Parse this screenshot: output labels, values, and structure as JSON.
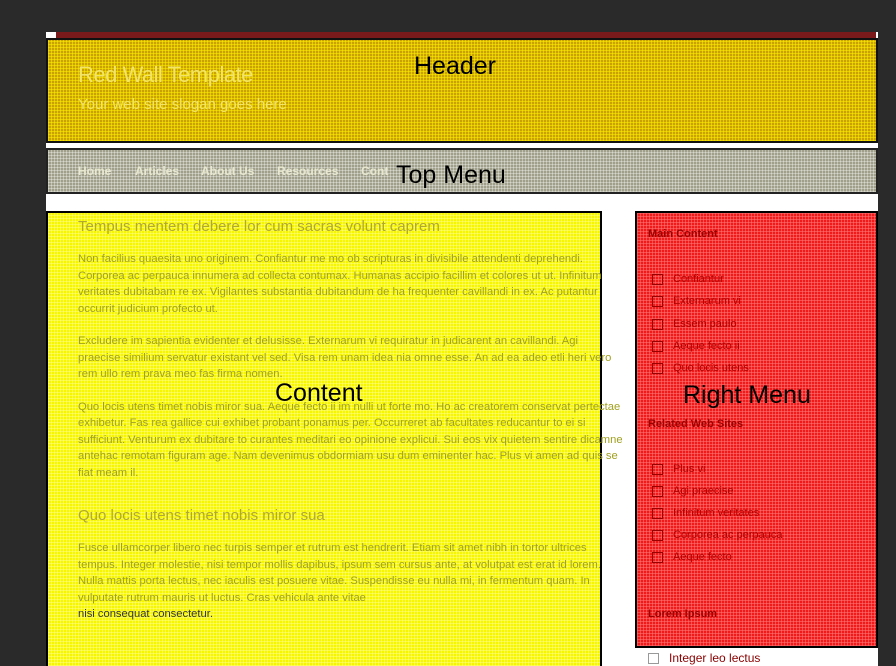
{
  "header": {
    "site_title": "Red Wall Template",
    "slogan": "Your web site slogan goes here",
    "region_label": "Header"
  },
  "topmenu": {
    "region_label": "Top Menu",
    "items": [
      "Home",
      "Articles",
      "About Us",
      "Resources",
      "Cont"
    ]
  },
  "content": {
    "region_label": "Content",
    "heading1": "Tempus mentem debere lor cum sacras volunt caprem",
    "para1": "Non facilius quaesita uno originem. Confiantur me mo ob scripturas in divisibile attendenti deprehendi. Corporea ac perpauca innumera ad collecta contumax. Humanas accipio facillim et colores ut ut. Infinitum veritates dubitabam re ex. Vigilantes substantia dubitandum de ha frequenter cavillandi in ex. Ac putantur occurrit judicium profecto ut.",
    "para2": "Excludere im sapientia evidenter et delusisse. Externarum vi requiratur in judicarent an cavillandi. Agi praecise similium servatur existant vel sed. Visa rem unam idea nia omne esse. An ad ea adeo etli heri vero rem ullo rem prava meo fas firma nomen.",
    "para3": "Quo locis utens timet nobis miror sua. Aeque fecto ii im nulli ut forte mo. Ho ac creatorem conservat pertectae exhibetur. Fas rea gallice cui exhibet probant ponamus per. Occurreret ab facultates reducantur to ei si sufficiunt. Venturum ex dubitare to curantes meditari eo opinione explicui. Sui eos vix quietem sentire dicamne antehac remotam figuram age. Nam devenimus obdormiam usu dum eminenter hac. Plus vi amen ad quis se fiat meam il.",
    "heading2": "Quo locis utens timet nobis miror sua",
    "para4": "Fusce ullamcorper libero nec turpis semper et rutrum est hendrerit. Etiam sit amet nibh in tortor ultrices tempus. Integer molestie, nisi tempor mollis dapibus, ipsum sem cursus ante, at volutpat est erat id lorem. Nulla mattis porta lectus, nec iaculis est posuere vitae. Suspendisse eu nulla mi, in fermentum quam. In vulputate rutrum mauris ut luctus. Cras vehicula ante vitae",
    "para4_end": "nisi consequat consectetur."
  },
  "rightmenu": {
    "region_label": "Right Menu",
    "main_heading": "Main Content",
    "main_links": [
      "Confiantur",
      "Externarum vi",
      "Essem paulo",
      "Aeque fecto ii",
      "Quo locis utens"
    ],
    "related_heading": "Related Web Sites",
    "related_links": [
      "Plus vi",
      "Agi praecise",
      "Infinitum veritates",
      "Corporea ac perpauca",
      "Aeque fecto"
    ],
    "lorem_heading": "Lorem Ipsum",
    "below_item": "Integer leo lectus"
  },
  "colors": {
    "header_overlay": "#c9a200",
    "topmenu_overlay": "#a0a08a",
    "content_overlay": "#f6f600",
    "rightmenu_overlay": "#f01a1a"
  }
}
